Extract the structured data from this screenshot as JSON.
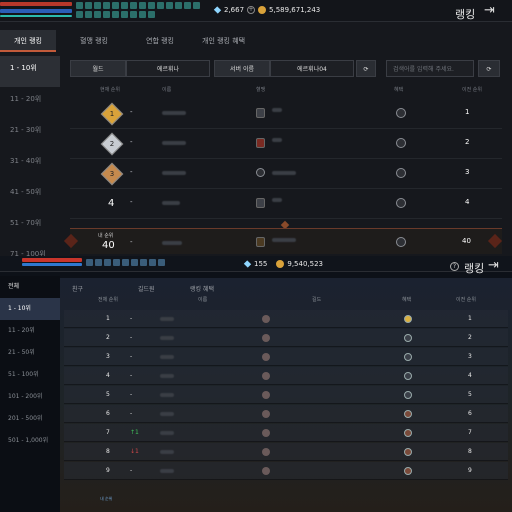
{
  "top": {
    "currency": {
      "gems": "2,667",
      "gold": "5,589,671,243"
    },
    "title": "랭킹",
    "tabs": [
      "개인 랭킹",
      "혈맹 랭킹",
      "연합 랭킹",
      "개인 랭킹 혜택"
    ],
    "side": [
      "1 - 10위",
      "11 - 20위",
      "21 - 30위",
      "31 - 40위",
      "41 - 50위",
      "51 - 70위",
      "71 - 100위"
    ],
    "filters": {
      "world_label": "월드",
      "world_value": "에르휘나",
      "server_label": "서버 이름",
      "server_value": "에르휘나04",
      "search_placeholder": "검색어를 입력해 주세요."
    },
    "headers": {
      "rank": "현재 순위",
      "name": "이름",
      "pledge": "혈맹",
      "benefit": "혜택",
      "prev": "이전 순위"
    },
    "rows": [
      {
        "rank": "1",
        "change": "-",
        "prev": "1"
      },
      {
        "rank": "2",
        "change": "-",
        "prev": "2"
      },
      {
        "rank": "3",
        "change": "-",
        "prev": "3"
      },
      {
        "rank": "4",
        "change": "-",
        "prev": "4"
      }
    ],
    "my": {
      "label": "내 순위",
      "rank": "40",
      "change": "-",
      "prev": "40"
    }
  },
  "bottom": {
    "currency": {
      "gems": "155",
      "gold": "9,540,523"
    },
    "title": "랭킹",
    "help": "?",
    "side": [
      "전체",
      "1 - 10위",
      "11 - 20위",
      "21 - 50위",
      "51 - 100위",
      "101 - 200위",
      "201 - 500위",
      "501 - 1,000위"
    ],
    "tabs": [
      "친구",
      "길드원",
      "랭킹 혜택"
    ],
    "headers": {
      "rank": "전체 순위",
      "name": "이름",
      "guild": "길드",
      "benefit": "혜택",
      "prev": "이전 순위"
    },
    "rows": [
      {
        "rank": "1",
        "change": "-",
        "prev": "1"
      },
      {
        "rank": "2",
        "change": "-",
        "prev": "2"
      },
      {
        "rank": "3",
        "change": "-",
        "prev": "3"
      },
      {
        "rank": "4",
        "change": "-",
        "prev": "4"
      },
      {
        "rank": "5",
        "change": "-",
        "prev": "5"
      },
      {
        "rank": "6",
        "change": "-",
        "prev": "6"
      },
      {
        "rank": "7",
        "change": "↑1",
        "prev": "7"
      },
      {
        "rank": "8",
        "change": "↓1",
        "prev": "8"
      },
      {
        "rank": "9",
        "change": "-",
        "prev": "9"
      }
    ],
    "my_label": "내 순위"
  },
  "colors": {
    "accent_top": "#c25a3a",
    "gold": "#d9a23a",
    "silver": "#c8ccd2",
    "bronze": "#c58a4e",
    "up": "#3fbf5a",
    "down": "#d04848"
  }
}
